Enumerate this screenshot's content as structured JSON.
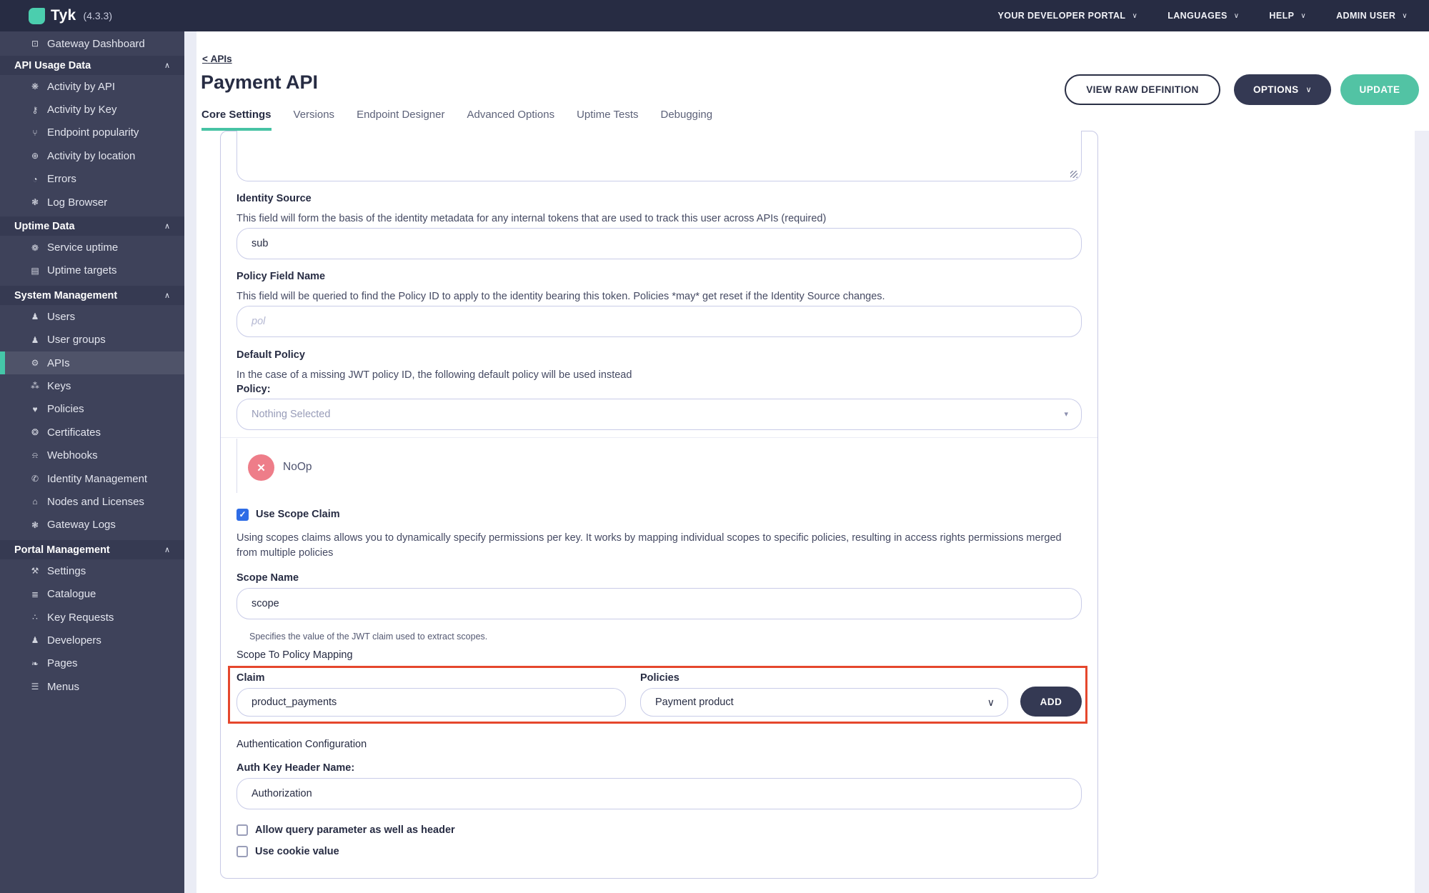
{
  "topbar": {
    "brand": "Tyk",
    "version": "(4.3.3)",
    "menu": [
      {
        "label": "YOUR DEVELOPER PORTAL"
      },
      {
        "label": "LANGUAGES"
      },
      {
        "label": "HELP"
      },
      {
        "label": "ADMIN USER"
      }
    ]
  },
  "sidebar": {
    "items": [
      {
        "label": "Gateway Dashboard",
        "icon": "monitor-icon",
        "type": "item"
      },
      {
        "label": "API Usage Data",
        "type": "section"
      },
      {
        "label": "Activity by API",
        "icon": "chart-icon",
        "type": "item"
      },
      {
        "label": "Activity by Key",
        "icon": "key-icon",
        "type": "item"
      },
      {
        "label": "Endpoint popularity",
        "icon": "branch-icon",
        "type": "item"
      },
      {
        "label": "Activity by location",
        "icon": "globe-icon",
        "type": "item"
      },
      {
        "label": "Errors",
        "icon": "pie-icon",
        "type": "item"
      },
      {
        "label": "Log Browser",
        "icon": "bug-icon",
        "type": "item"
      },
      {
        "label": "Uptime Data",
        "type": "section"
      },
      {
        "label": "Service uptime",
        "icon": "gauge-icon",
        "type": "item"
      },
      {
        "label": "Uptime targets",
        "icon": "list-icon",
        "type": "item"
      },
      {
        "label": "System Management",
        "type": "section"
      },
      {
        "label": "Users",
        "icon": "user-icon",
        "type": "item"
      },
      {
        "label": "User groups",
        "icon": "users-icon",
        "type": "item"
      },
      {
        "label": "APIs",
        "icon": "gears-icon",
        "type": "item",
        "active": true
      },
      {
        "label": "Keys",
        "icon": "sitemap-icon",
        "type": "item"
      },
      {
        "label": "Policies",
        "icon": "badge-icon",
        "type": "item"
      },
      {
        "label": "Certificates",
        "icon": "seal-icon",
        "type": "item"
      },
      {
        "label": "Webhooks",
        "icon": "bell-icon",
        "type": "item"
      },
      {
        "label": "Identity Management",
        "icon": "phone-icon",
        "type": "item"
      },
      {
        "label": "Nodes and Licenses",
        "icon": "bank-icon",
        "type": "item"
      },
      {
        "label": "Gateway Logs",
        "icon": "bug-icon",
        "type": "item"
      },
      {
        "label": "Portal Management",
        "type": "section"
      },
      {
        "label": "Settings",
        "icon": "wrench-icon",
        "type": "item"
      },
      {
        "label": "Catalogue",
        "icon": "stack-icon",
        "type": "item"
      },
      {
        "label": "Key Requests",
        "icon": "paw-icon",
        "type": "item"
      },
      {
        "label": "Developers",
        "icon": "users-icon",
        "type": "item"
      },
      {
        "label": "Pages",
        "icon": "leaf-icon",
        "type": "item"
      },
      {
        "label": "Menus",
        "icon": "menu-icon",
        "type": "item"
      }
    ]
  },
  "header": {
    "breadcrumb": {
      "chevron": "<",
      "label": "APIs"
    },
    "title": "Payment API",
    "buttons": {
      "view_raw": "VIEW RAW DEFINITION",
      "options": "OPTIONS",
      "update": "UPDATE"
    }
  },
  "tabs": {
    "items": [
      "Core Settings",
      "Versions",
      "Endpoint Designer",
      "Advanced Options",
      "Uptime Tests",
      "Debugging"
    ],
    "active": "Core Settings"
  },
  "form": {
    "identity_source": {
      "label": "Identity Source",
      "description": "This field will form the basis of the identity metadata for any internal tokens that are used to track this user across APIs (required)",
      "value": "sub"
    },
    "policy_field_name": {
      "label": "Policy Field Name",
      "description": "This field will be queried to find the Policy ID to apply to the identity bearing this token. Policies *may* get reset if the Identity Source changes.",
      "placeholder": "pol"
    },
    "default_policy": {
      "label": "Default Policy",
      "description": "In the case of a missing JWT policy ID, the following default policy will be used instead",
      "policy_label": "Policy:",
      "select_value": "Nothing Selected"
    },
    "noop": {
      "label": "NoOp"
    },
    "use_scope_claim": {
      "label": "Use Scope Claim",
      "checked": true,
      "description": "Using scopes claims allows you to dynamically specify permissions per key. It works by mapping individual scopes to specific policies, resulting in access rights permissions merged from multiple policies"
    },
    "scope_name": {
      "label": "Scope Name",
      "value": "scope",
      "helper": "Specifies the value of the JWT claim used to extract scopes."
    },
    "scope_to_policy": {
      "label": "Scope To Policy Mapping",
      "claim_label": "Claim",
      "claim_value": "product_payments",
      "policies_label": "Policies",
      "policies_value": "Payment product",
      "add_label": "ADD"
    },
    "auth": {
      "section_label": "Authentication Configuration",
      "header_label": "Auth Key Header Name:",
      "value": "Authorization",
      "checkbox_query": "Allow query parameter as well as header",
      "checkbox_cookie": "Use cookie value"
    }
  },
  "colors": {
    "accent_teal": "#47c3a4",
    "highlight_red": "#e5472d",
    "checkbox_blue": "#2e6ce6",
    "noop_pink": "#ee7d89",
    "topbar_bg": "#272c43",
    "sidebar_bg": "#3e425a"
  }
}
